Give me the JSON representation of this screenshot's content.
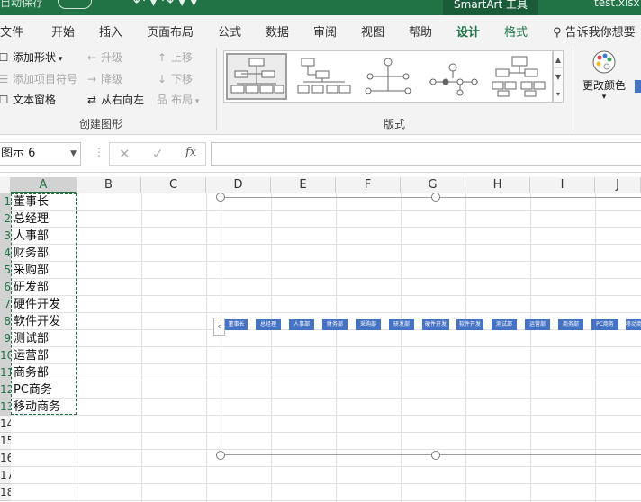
{
  "titlebar": {
    "autosave": "自动保存",
    "context_tab": "SmartArt 工具",
    "filename": "test.xlsx"
  },
  "tabs": [
    "文件",
    "开始",
    "插入",
    "页面布局",
    "公式",
    "数据",
    "审阅",
    "视图",
    "帮助",
    "设计",
    "格式"
  ],
  "active_tab": "设计",
  "tell_me": "告诉我你想要",
  "ribbon": {
    "create_group": {
      "add_shape": "添加形状",
      "add_bullet": "添加项目符号",
      "text_pane": "文本窗格",
      "promote": "升级",
      "demote": "降级",
      "right_to_left": "从右向左",
      "move_up": "上移",
      "move_down": "下移",
      "layout": "布局",
      "label": "创建图形"
    },
    "layouts_group": {
      "label": "版式"
    },
    "change_colors": "更改颜色"
  },
  "formula_bar": {
    "name_box": "图示 6",
    "cancel": "✕",
    "enter": "✓",
    "fx": "fx",
    "formula": ""
  },
  "sheet": {
    "columns": [
      "A",
      "B",
      "C",
      "D",
      "E",
      "F",
      "G",
      "H",
      "I",
      "J"
    ],
    "selected_column": "A",
    "rows": [
      "1",
      "2",
      "3",
      "4",
      "5",
      "6",
      "7",
      "8",
      "9",
      "10",
      "11",
      "12",
      "13",
      "14",
      "15",
      "16",
      "17",
      "18"
    ],
    "cells_a": [
      "董事长",
      "总经理",
      "人事部",
      "财务部",
      "采购部",
      "研发部",
      "硬件开发",
      "软件开发",
      "测试部",
      "运营部",
      "商务部",
      "PC商务",
      "移动商务"
    ]
  },
  "smartart": {
    "nodes": [
      "董事长",
      "总经理",
      "人事部",
      "财务部",
      "采购部",
      "研发部",
      "硬件开发",
      "软件开发",
      "测试部",
      "运营部",
      "商务部",
      "PC商务",
      "移动商务"
    ],
    "node_color": "#4472c4",
    "toggle_icon": "chevron-left-icon"
  },
  "colors": {
    "accent": "#217346",
    "node": "#4472c4"
  }
}
